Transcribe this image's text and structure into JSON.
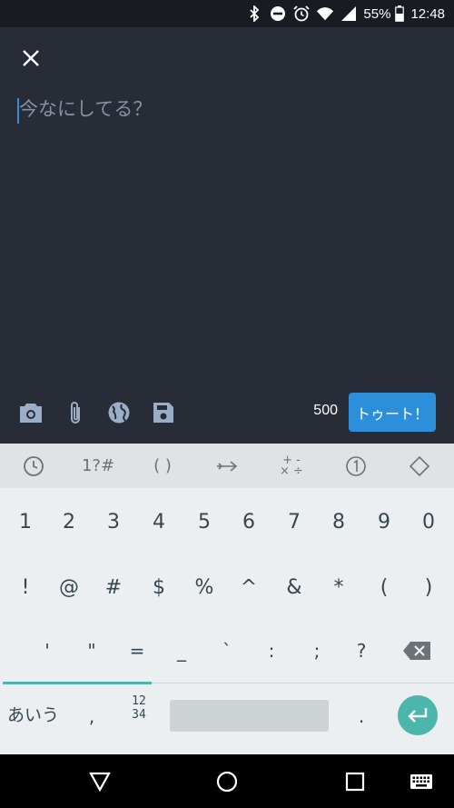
{
  "status_bar": {
    "battery": "55%",
    "time": "12:48",
    "icons": [
      "bluetooth-icon",
      "do-not-disturb-icon",
      "alarm-icon",
      "wifi-icon",
      "cell-signal-icon",
      "battery-icon"
    ]
  },
  "compose": {
    "placeholder": "今なにしてる？",
    "value": "",
    "char_count": "500",
    "submit_label": "トゥート！",
    "tools": [
      "camera-icon",
      "attachment-icon",
      "globe-icon",
      "save-icon"
    ]
  },
  "keyboard": {
    "tabs": [
      "clock-icon",
      "1?#",
      "( )",
      "arrow-icon",
      "math-ops",
      "circled-one",
      "diamond-icon"
    ],
    "tab_math": "+ -\n× ÷",
    "row1": [
      "1",
      "2",
      "3",
      "4",
      "5",
      "6",
      "7",
      "8",
      "9",
      "0"
    ],
    "row2": [
      "!",
      "@",
      "#",
      "$",
      "%",
      "^",
      "&",
      "*",
      "(",
      ")"
    ],
    "row3": [
      "'",
      "\"",
      "=",
      "_",
      "`",
      ":",
      ";",
      "?"
    ],
    "mode_label": "あいう",
    "comma": ",",
    "num_top": "12",
    "num_bottom": "34",
    "period": "."
  },
  "colors": {
    "background": "#282c37",
    "accent": "#2b90d9",
    "keyboard_accent": "#4db6ac"
  }
}
